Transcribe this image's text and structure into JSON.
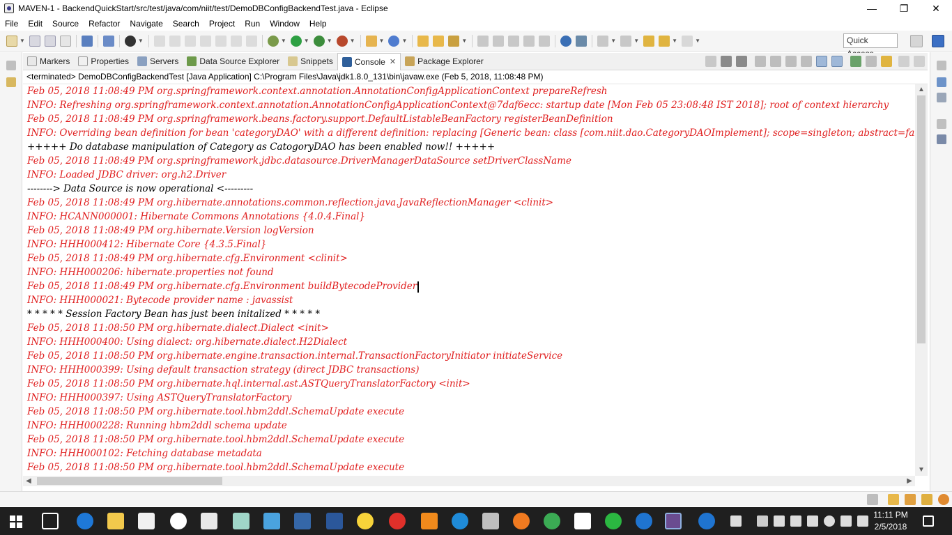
{
  "window": {
    "title": "MAVEN-1 - BackendQuickStart/src/test/java/com/niit/test/DemoDBConfigBackendTest.java - Eclipse",
    "minimize": "—",
    "restore": "❐",
    "close": "✕"
  },
  "menu": [
    "File",
    "Edit",
    "Source",
    "Refactor",
    "Navigate",
    "Search",
    "Project",
    "Run",
    "Window",
    "Help"
  ],
  "toolbar": {
    "quick_access": "Quick Access"
  },
  "view_tabs": [
    {
      "label": "Markers",
      "icon": "markers-icon"
    },
    {
      "label": "Properties",
      "icon": "properties-icon"
    },
    {
      "label": "Servers",
      "icon": "servers-icon"
    },
    {
      "label": "Data Source Explorer",
      "icon": "datasource-icon"
    },
    {
      "label": "Snippets",
      "icon": "snippets-icon"
    },
    {
      "label": "Console",
      "icon": "console-icon",
      "active": true
    },
    {
      "label": "Package Explorer",
      "icon": "package-explorer-icon"
    }
  ],
  "console": {
    "header": "<terminated> DemoDBConfigBackendTest [Java Application] C:\\Program Files\\Java\\jdk1.8.0_131\\bin\\javaw.exe (Feb 5, 2018, 11:08:48 PM)",
    "lines": [
      {
        "text": "Feb 05, 2018 11:08:49 PM org.springframework.context.annotation.AnnotationConfigApplicationContext prepareRefresh",
        "stream": "err"
      },
      {
        "text": "INFO: Refreshing org.springframework.context.annotation.AnnotationConfigApplicationContext@7daf6ecc: startup date [Mon Feb 05 23:08:48 IST 2018]; root of context hierarchy",
        "stream": "err"
      },
      {
        "text": "Feb 05, 2018 11:08:49 PM org.springframework.beans.factory.support.DefaultListableBeanFactory registerBeanDefinition",
        "stream": "err"
      },
      {
        "text": "INFO: Overriding bean definition for bean 'categoryDAO' with a different definition: replacing [Generic bean: class [com.niit.dao.CategoryDAOImplement]; scope=singleton; abstract=false; lazyIn",
        "stream": "err"
      },
      {
        "text": "+++++ Do database manipulation of Category as CatogoryDAO has been enabled now!! +++++",
        "stream": "out"
      },
      {
        "text": "Feb 05, 2018 11:08:49 PM org.springframework.jdbc.datasource.DriverManagerDataSource setDriverClassName",
        "stream": "err"
      },
      {
        "text": "INFO: Loaded JDBC driver: org.h2.Driver",
        "stream": "err"
      },
      {
        "text": "-------->  Data Source is now operational  <---------",
        "stream": "out"
      },
      {
        "text": "Feb 05, 2018 11:08:49 PM org.hibernate.annotations.common.reflection.java.JavaReflectionManager <clinit>",
        "stream": "err"
      },
      {
        "text": "INFO: HCANN000001: Hibernate Commons Annotations {4.0.4.Final}",
        "stream": "err"
      },
      {
        "text": "Feb 05, 2018 11:08:49 PM org.hibernate.Version logVersion",
        "stream": "err"
      },
      {
        "text": "INFO: HHH000412: Hibernate Core {4.3.5.Final}",
        "stream": "err"
      },
      {
        "text": "Feb 05, 2018 11:08:49 PM org.hibernate.cfg.Environment <clinit>",
        "stream": "err"
      },
      {
        "text": "INFO: HHH000206: hibernate.properties not found",
        "stream": "err"
      },
      {
        "text": "Feb 05, 2018 11:08:49 PM org.hibernate.cfg.Environment buildBytecodeProvider",
        "stream": "err",
        "caret": true
      },
      {
        "text": "INFO: HHH000021: Bytecode provider name : javassist",
        "stream": "err"
      },
      {
        "text": " * * * * * Session Factory Bean has just been initalized * * * * *",
        "stream": "out"
      },
      {
        "text": "Feb 05, 2018 11:08:50 PM org.hibernate.dialect.Dialect <init>",
        "stream": "err"
      },
      {
        "text": "INFO: HHH000400: Using dialect: org.hibernate.dialect.H2Dialect",
        "stream": "err"
      },
      {
        "text": "Feb 05, 2018 11:08:50 PM org.hibernate.engine.transaction.internal.TransactionFactoryInitiator initiateService",
        "stream": "err"
      },
      {
        "text": "INFO: HHH000399: Using default transaction strategy (direct JDBC transactions)",
        "stream": "err"
      },
      {
        "text": "Feb 05, 2018 11:08:50 PM org.hibernate.hql.internal.ast.ASTQueryTranslatorFactory <init>",
        "stream": "err"
      },
      {
        "text": "INFO: HHH000397: Using ASTQueryTranslatorFactory",
        "stream": "err"
      },
      {
        "text": "Feb 05, 2018 11:08:50 PM org.hibernate.tool.hbm2ddl.SchemaUpdate execute",
        "stream": "err"
      },
      {
        "text": "INFO: HHH000228: Running hbm2ddl schema update",
        "stream": "err"
      },
      {
        "text": "Feb 05, 2018 11:08:50 PM org.hibernate.tool.hbm2ddl.SchemaUpdate execute",
        "stream": "err"
      },
      {
        "text": "INFO: HHH000102: Fetching database metadata",
        "stream": "err"
      },
      {
        "text": "Feb 05, 2018 11:08:50 PM org.hibernate.tool.hbm2ddl.SchemaUpdate execute",
        "stream": "err"
      }
    ]
  },
  "taskbar": {
    "time": "11:11 PM",
    "date": "2/5/2018"
  },
  "colors": {
    "stderr": "#e02020",
    "stdout": "#000000",
    "taskbar": "#1f1f1f"
  }
}
